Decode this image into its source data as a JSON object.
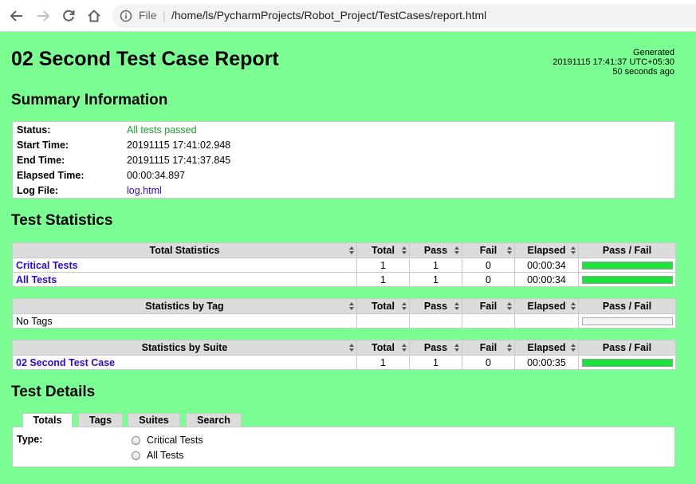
{
  "browser": {
    "scheme_label": "File",
    "separator": "|",
    "url": "/home/ls/PycharmProjects/Robot_Project/TestCases/report.html"
  },
  "header": {
    "title": "02 Second Test Case Report",
    "generated_label": "Generated",
    "generated_time": "20191115 17:41:37 UTC+05:30",
    "generated_ago": "50 seconds ago"
  },
  "summary": {
    "heading": "Summary Information",
    "rows": [
      {
        "label": "Status:",
        "value": "All tests passed"
      },
      {
        "label": "Start Time:",
        "value": "20191115 17:41:02.948"
      },
      {
        "label": "End Time:",
        "value": "20191115 17:41:37.845"
      },
      {
        "label": "Elapsed Time:",
        "value": "00:00:34.897"
      },
      {
        "label": "Log File:",
        "value": "log.html"
      }
    ]
  },
  "statistics": {
    "heading": "Test Statistics",
    "columns": [
      "Total",
      "Pass",
      "Fail",
      "Elapsed",
      "Pass / Fail"
    ],
    "total_table": {
      "header": "Total Statistics",
      "rows": [
        {
          "name": "Critical Tests",
          "total": "1",
          "pass": "1",
          "fail": "0",
          "elapsed": "00:00:34",
          "pass_ratio": 1.0
        },
        {
          "name": "All Tests",
          "total": "1",
          "pass": "1",
          "fail": "0",
          "elapsed": "00:00:34",
          "pass_ratio": 1.0
        }
      ]
    },
    "tag_table": {
      "header": "Statistics by Tag",
      "rows": [
        {
          "name": "No Tags"
        }
      ]
    },
    "suite_table": {
      "header": "Statistics by Suite",
      "rows": [
        {
          "name": "02 Second Test Case",
          "total": "1",
          "pass": "1",
          "fail": "0",
          "elapsed": "00:00:35",
          "pass_ratio": 1.0
        }
      ]
    }
  },
  "details": {
    "heading": "Test Details",
    "tabs": [
      "Totals",
      "Tags",
      "Suites",
      "Search"
    ],
    "active_tab": "Totals",
    "type_label": "Type:",
    "options": [
      "Critical Tests",
      "All Tests"
    ]
  },
  "colors": {
    "page_background": "#7cff92",
    "pass_green": "#1be33a",
    "link": "#2a0bd6"
  }
}
